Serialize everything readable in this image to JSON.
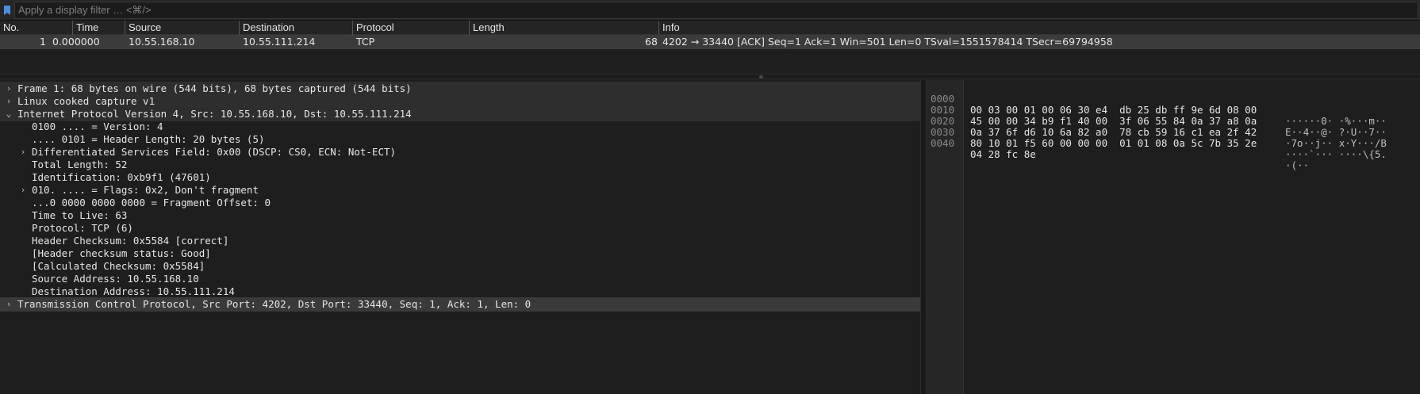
{
  "filter": {
    "placeholder": "Apply a display filter … <⌘/>",
    "value": ""
  },
  "packet_list": {
    "columns": [
      "No.",
      "Time",
      "Source",
      "Destination",
      "Protocol",
      "Length",
      "Info"
    ],
    "rows": [
      {
        "no": "1",
        "time": "0.000000",
        "source": "10.55.168.10",
        "destination": "10.55.111.214",
        "protocol": "TCP",
        "length": "68",
        "info": "4202 → 33440 [ACK] Seq=1 Ack=1 Win=501 Len=0 TSval=1551578414 TSecr=69794958"
      }
    ]
  },
  "details": {
    "items": [
      {
        "text": "Frame 1: 68 bytes on wire (544 bits), 68 bytes captured (544 bits)",
        "arrow": "›",
        "level": 0,
        "section": true
      },
      {
        "text": "Linux cooked capture v1",
        "arrow": "›",
        "level": 0,
        "section": true
      },
      {
        "text": "Internet Protocol Version 4, Src: 10.55.168.10, Dst: 10.55.111.214",
        "arrow": "⌄",
        "level": 0,
        "section": true
      },
      {
        "text": "0100 .... = Version: 4",
        "arrow": "",
        "level": 1
      },
      {
        "text": ".... 0101 = Header Length: 20 bytes (5)",
        "arrow": "",
        "level": 1
      },
      {
        "text": "Differentiated Services Field: 0x00 (DSCP: CS0, ECN: Not-ECT)",
        "arrow": "›",
        "level": 1
      },
      {
        "text": "Total Length: 52",
        "arrow": "",
        "level": 1
      },
      {
        "text": "Identification: 0xb9f1 (47601)",
        "arrow": "",
        "level": 1
      },
      {
        "text": "010. .... = Flags: 0x2, Don't fragment",
        "arrow": "›",
        "level": 1
      },
      {
        "text": "...0 0000 0000 0000 = Fragment Offset: 0",
        "arrow": "",
        "level": 1
      },
      {
        "text": "Time to Live: 63",
        "arrow": "",
        "level": 1
      },
      {
        "text": "Protocol: TCP (6)",
        "arrow": "",
        "level": 1
      },
      {
        "text": "Header Checksum: 0x5584 [correct]",
        "arrow": "",
        "level": 1
      },
      {
        "text": "[Header checksum status: Good]",
        "arrow": "",
        "level": 1
      },
      {
        "text": "[Calculated Checksum: 0x5584]",
        "arrow": "",
        "level": 1
      },
      {
        "text": "Source Address: 10.55.168.10",
        "arrow": "",
        "level": 1
      },
      {
        "text": "Destination Address: 10.55.111.214",
        "arrow": "",
        "level": 1
      },
      {
        "text": "Transmission Control Protocol, Src Port: 4202, Dst Port: 33440, Seq: 1, Ack: 1, Len: 0",
        "arrow": "›",
        "level": 0,
        "section": true,
        "highlight": true
      }
    ]
  },
  "hex": {
    "lines": [
      {
        "offset": "0000",
        "bytes": "00 03 00 01 00 06 30 e4  db 25 db ff 9e 6d 08 00",
        "ascii": "······0· ·%···m··"
      },
      {
        "offset": "0010",
        "bytes": "45 00 00 34 b9 f1 40 00  3f 06 55 84 0a 37 a8 0a",
        "ascii": "E··4··@· ?·U··7··"
      },
      {
        "offset": "0020",
        "bytes": "0a 37 6f d6 10 6a 82 a0  78 cb 59 16 c1 ea 2f 42",
        "ascii": "·7o··j·· x·Y···/B"
      },
      {
        "offset": "0030",
        "bytes": "80 10 01 f5 60 00 00 00  01 01 08 0a 5c 7b 35 2e",
        "ascii": "····`··· ····\\{5."
      },
      {
        "offset": "0040",
        "bytes": "04 28 fc 8e",
        "ascii": "·(··"
      }
    ]
  },
  "colors": {
    "selected_row": "#3b3b3b",
    "section_bg": "#2e2e2e",
    "accent_bookmark": "#4a90e2"
  }
}
